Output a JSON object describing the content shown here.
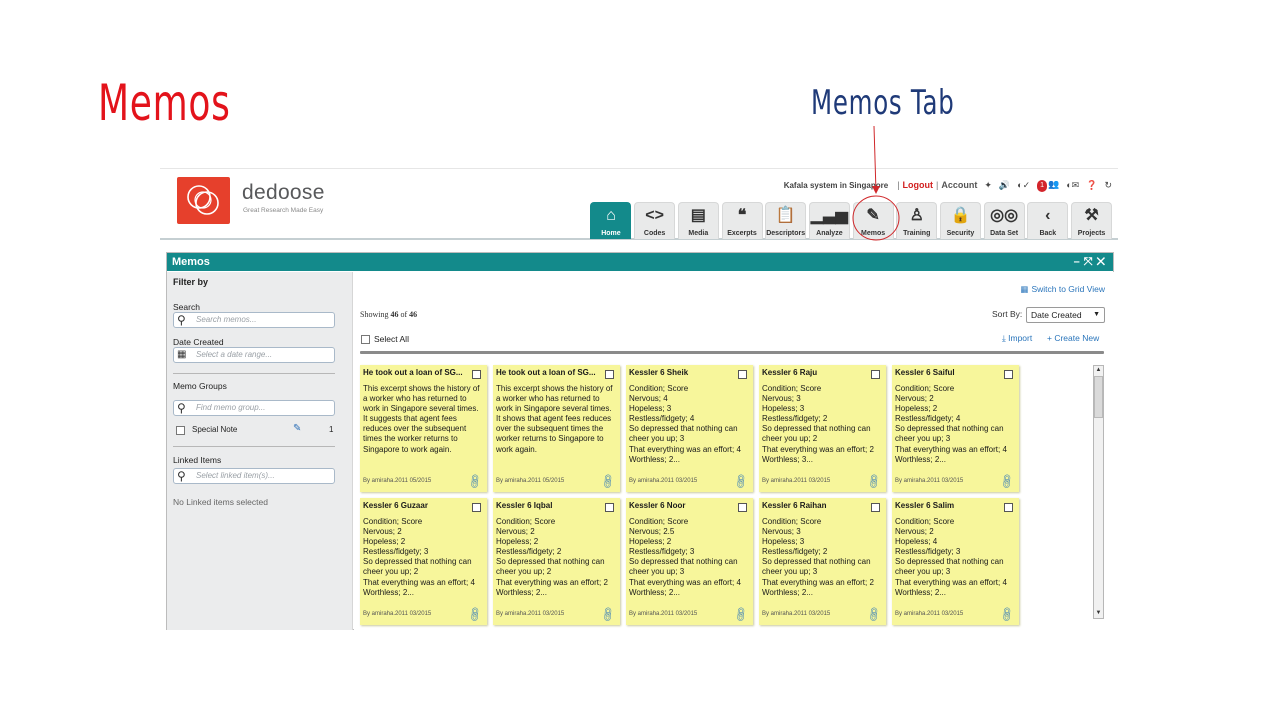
{
  "slide": {
    "title": "Memos",
    "callout_label": "Memos Tab"
  },
  "brand": {
    "name": "dedoose",
    "tagline": "Great Research Made Easy"
  },
  "top_bar": {
    "project_name": "Kafala system in Singapore",
    "logout_label": "Logout",
    "account_label": "Account",
    "notification_count": "1"
  },
  "nav_tabs": [
    {
      "label": "Home",
      "icon": "home-icon",
      "glyph": "⌂"
    },
    {
      "label": "Codes",
      "icon": "code-brackets-icon",
      "glyph": "<>"
    },
    {
      "label": "Media",
      "icon": "newspaper-icon",
      "glyph": "▤"
    },
    {
      "label": "Excerpts",
      "icon": "quote-icon",
      "glyph": "❝"
    },
    {
      "label": "Descriptors",
      "icon": "clipboard-icon",
      "glyph": "📋"
    },
    {
      "label": "Analyze",
      "icon": "bar-chart-icon",
      "glyph": "▁▃▅"
    },
    {
      "label": "Memos",
      "icon": "memo-note-icon",
      "glyph": "✎"
    },
    {
      "label": "Training",
      "icon": "person-icon",
      "glyph": "♙"
    },
    {
      "label": "Security",
      "icon": "lock-icon",
      "glyph": "🔒"
    },
    {
      "label": "Data Set",
      "icon": "binoculars-icon",
      "glyph": "◎◎"
    },
    {
      "label": "Back",
      "icon": "chevron-left-icon",
      "glyph": "‹"
    },
    {
      "label": "Projects",
      "icon": "tools-icon",
      "glyph": "⚒"
    }
  ],
  "panel": {
    "title": "Memos"
  },
  "sidebar": {
    "heading": "Filter by",
    "search_label": "Search",
    "search_placeholder": "Search memos...",
    "date_label": "Date Created",
    "date_placeholder": "Select a date range...",
    "groups_label": "Memo Groups",
    "groups_placeholder": "Find memo group...",
    "group_item_label": "Special Note",
    "group_item_count": "1",
    "linked_label": "Linked Items",
    "linked_placeholder": "Select linked item(s)...",
    "linked_empty": "No Linked items selected"
  },
  "main": {
    "grid_view_label": "Switch to Grid View",
    "showing_prefix": "Showing",
    "showing_count": "46",
    "showing_of": "of",
    "showing_total": "46",
    "sort_label": "Sort By:",
    "sort_value": "Date Created",
    "select_all_label": "Select All",
    "import_label": "Import",
    "create_new_label": "Create New"
  },
  "memos": [
    {
      "title": "He took out a loan of SG...",
      "body": "This excerpt shows the history of a worker who has returned to work in Singapore several times. It suggests that agent fees reduces over the subsequent times the worker returns to Singapore to work again.",
      "meta": "By amiraha.2011 05/2015"
    },
    {
      "title": "He took out a loan of SG...",
      "body": "This excerpt shows the history of a worker who has returned to work in Singapore several times. It shows that agent fees reduces over the subsequent times the worker returns to Singapore to work again.",
      "meta": "By amiraha.2011 05/2015"
    },
    {
      "title": "Kessler 6 Sheik",
      "body": "Condition; Score\nNervous; 4\nHopeless; 3\nRestless/fidgety; 4\nSo depressed that nothing can cheer you up; 3\nThat everything was an effort; 4\nWorthless; 2...",
      "meta": "By amiraha.2011 03/2015"
    },
    {
      "title": "Kessler 6 Raju",
      "body": "Condition; Score\nNervous; 3\nHopeless; 3\nRestless/fidgety; 2\nSo depressed that nothing can cheer you up; 2\nThat everything was an effort; 2\nWorthless; 3...",
      "meta": "By amiraha.2011 03/2015"
    },
    {
      "title": "Kessler 6 Saiful",
      "body": "Condition; Score\nNervous; 2\nHopeless; 2\nRestless/fidgety; 4\nSo depressed that nothing can cheer you up; 3\nThat everything was an effort; 4\nWorthless; 2...",
      "meta": "By amiraha.2011 03/2015"
    },
    {
      "title": "Kessler 6 Guzaar",
      "body": "Condition; Score\nNervous; 2\nHopeless; 2\nRestless/fidgety; 3\nSo depressed that nothing can cheer you up; 2\nThat everything was an effort; 4\nWorthless; 2...",
      "meta": "By amiraha.2011 03/2015"
    },
    {
      "title": "Kessler 6 Iqbal",
      "body": "Condition; Score\nNervous; 2\nHopeless; 2\nRestless/fidgety; 2\nSo depressed that nothing can cheer you up; 2\nThat everything was an effort; 2\nWorthless; 2...",
      "meta": "By amiraha.2011 03/2015"
    },
    {
      "title": "Kessler 6 Noor",
      "body": "Condition; Score\nNervous; 2.5\nHopeless; 2\nRestless/fidgety; 3\nSo depressed that nothing can cheer you up; 3\nThat everything was an effort; 4\nWorthless; 2...",
      "meta": "By amiraha.2011 03/2015"
    },
    {
      "title": "Kessler 6 Raihan",
      "body": "Condition; Score\nNervous; 3\nHopeless; 3\nRestless/fidgety; 2\nSo depressed that nothing can cheer you up; 3\nThat everything was an effort; 2\nWorthless; 2...",
      "meta": "By amiraha.2011 03/2015"
    },
    {
      "title": "Kessler 6 Salim",
      "body": "Condition; Score\nNervous; 2\nHopeless; 4\nRestless/fidgety; 3\nSo depressed that nothing can cheer you up; 3\nThat everything was an effort; 4\nWorthless; 2...",
      "meta": "By amiraha.2011 03/2015"
    }
  ],
  "colors": {
    "slide_title": "#e3131b",
    "callout": "#1f3a78",
    "brand_teal": "#138a8b",
    "logo_red": "#e6402c",
    "memo_yellow": "#f7f69b",
    "link_blue": "#2a75bb"
  }
}
